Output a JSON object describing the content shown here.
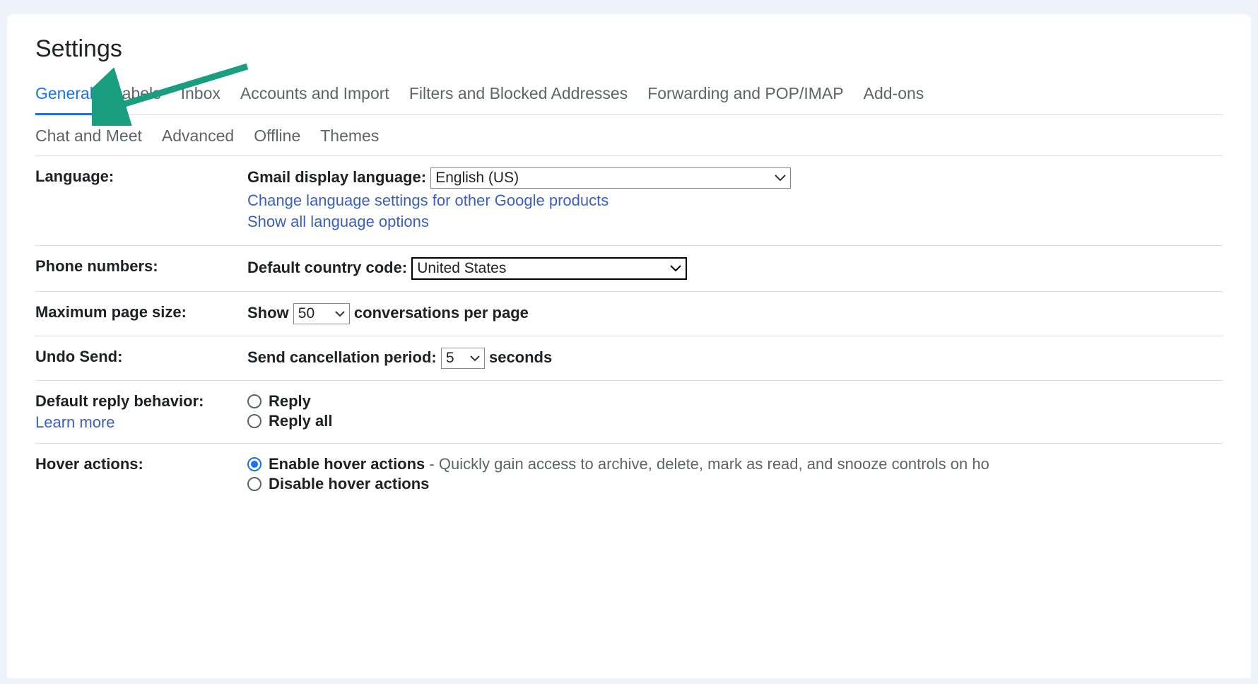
{
  "title": "Settings",
  "tabs_row1": [
    {
      "label": "General",
      "active": true
    },
    {
      "label": "Labels",
      "active": false
    },
    {
      "label": "Inbox",
      "active": false
    },
    {
      "label": "Accounts and Import",
      "active": false
    },
    {
      "label": "Filters and Blocked Addresses",
      "active": false
    },
    {
      "label": "Forwarding and POP/IMAP",
      "active": false
    },
    {
      "label": "Add-ons",
      "active": false
    }
  ],
  "tabs_row2": [
    {
      "label": "Chat and Meet"
    },
    {
      "label": "Advanced"
    },
    {
      "label": "Offline"
    },
    {
      "label": "Themes"
    }
  ],
  "language": {
    "label": "Language:",
    "display_label": "Gmail display language:",
    "selected": "English (US)",
    "link_change": "Change language settings for other Google products",
    "link_show_all": "Show all language options"
  },
  "phone": {
    "label": "Phone numbers:",
    "cc_label": "Default country code:",
    "cc_selected": "United States"
  },
  "pagesize": {
    "label": "Maximum page size:",
    "show": "Show",
    "value": "50",
    "suffix": "conversations per page"
  },
  "undo": {
    "label": "Undo Send:",
    "prefix": "Send cancellation period:",
    "value": "5",
    "suffix": "seconds"
  },
  "reply": {
    "label": "Default reply behavior:",
    "learn_more": "Learn more",
    "options": [
      "Reply",
      "Reply all"
    ],
    "selected": ""
  },
  "hover": {
    "label": "Hover actions:",
    "options": [
      {
        "label": "Enable hover actions",
        "desc": " - Quickly gain access to archive, delete, mark as read, and snooze controls on ho",
        "checked": true
      },
      {
        "label": "Disable hover actions",
        "desc": "",
        "checked": false
      }
    ]
  }
}
